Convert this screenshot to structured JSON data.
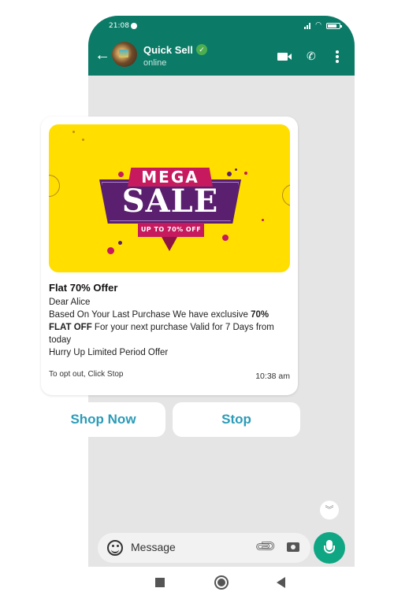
{
  "status_bar": {
    "time": "21:08"
  },
  "header": {
    "contact_name": "Quick Sell",
    "contact_status": "online",
    "verified": true,
    "icons": [
      "back-arrow-icon",
      "video-call-icon",
      "voice-call-icon",
      "more-options-icon"
    ]
  },
  "message": {
    "banner": {
      "line1": "MEGA",
      "line2": "SALE",
      "line3": "UP TO 70% OFF",
      "colors": {
        "background": "#ffde00",
        "primary": "#5a1f6e",
        "accent": "#c6195e"
      }
    },
    "title": "Flat 70% Offer",
    "body": {
      "greeting": "Dear Alice",
      "line_a": "Based On Your Last Purchase We have exclusive ",
      "highlight": "70% FLAT OFF",
      "line_b": " For your next purchase Valid for 7 Days from today",
      "line_c": "Hurry Up Limited Period Offer"
    },
    "footer": "To opt out, Click Stop",
    "time": "10:38 am"
  },
  "quick_replies": [
    {
      "label": "Shop Now"
    },
    {
      "label": "Stop"
    }
  ],
  "composer": {
    "placeholder": "Message"
  },
  "colors": {
    "header": "#0b7b68",
    "button_text": "#2a9bb8",
    "mic": "#0fa684",
    "chat_bg": "#e5e5e5"
  }
}
